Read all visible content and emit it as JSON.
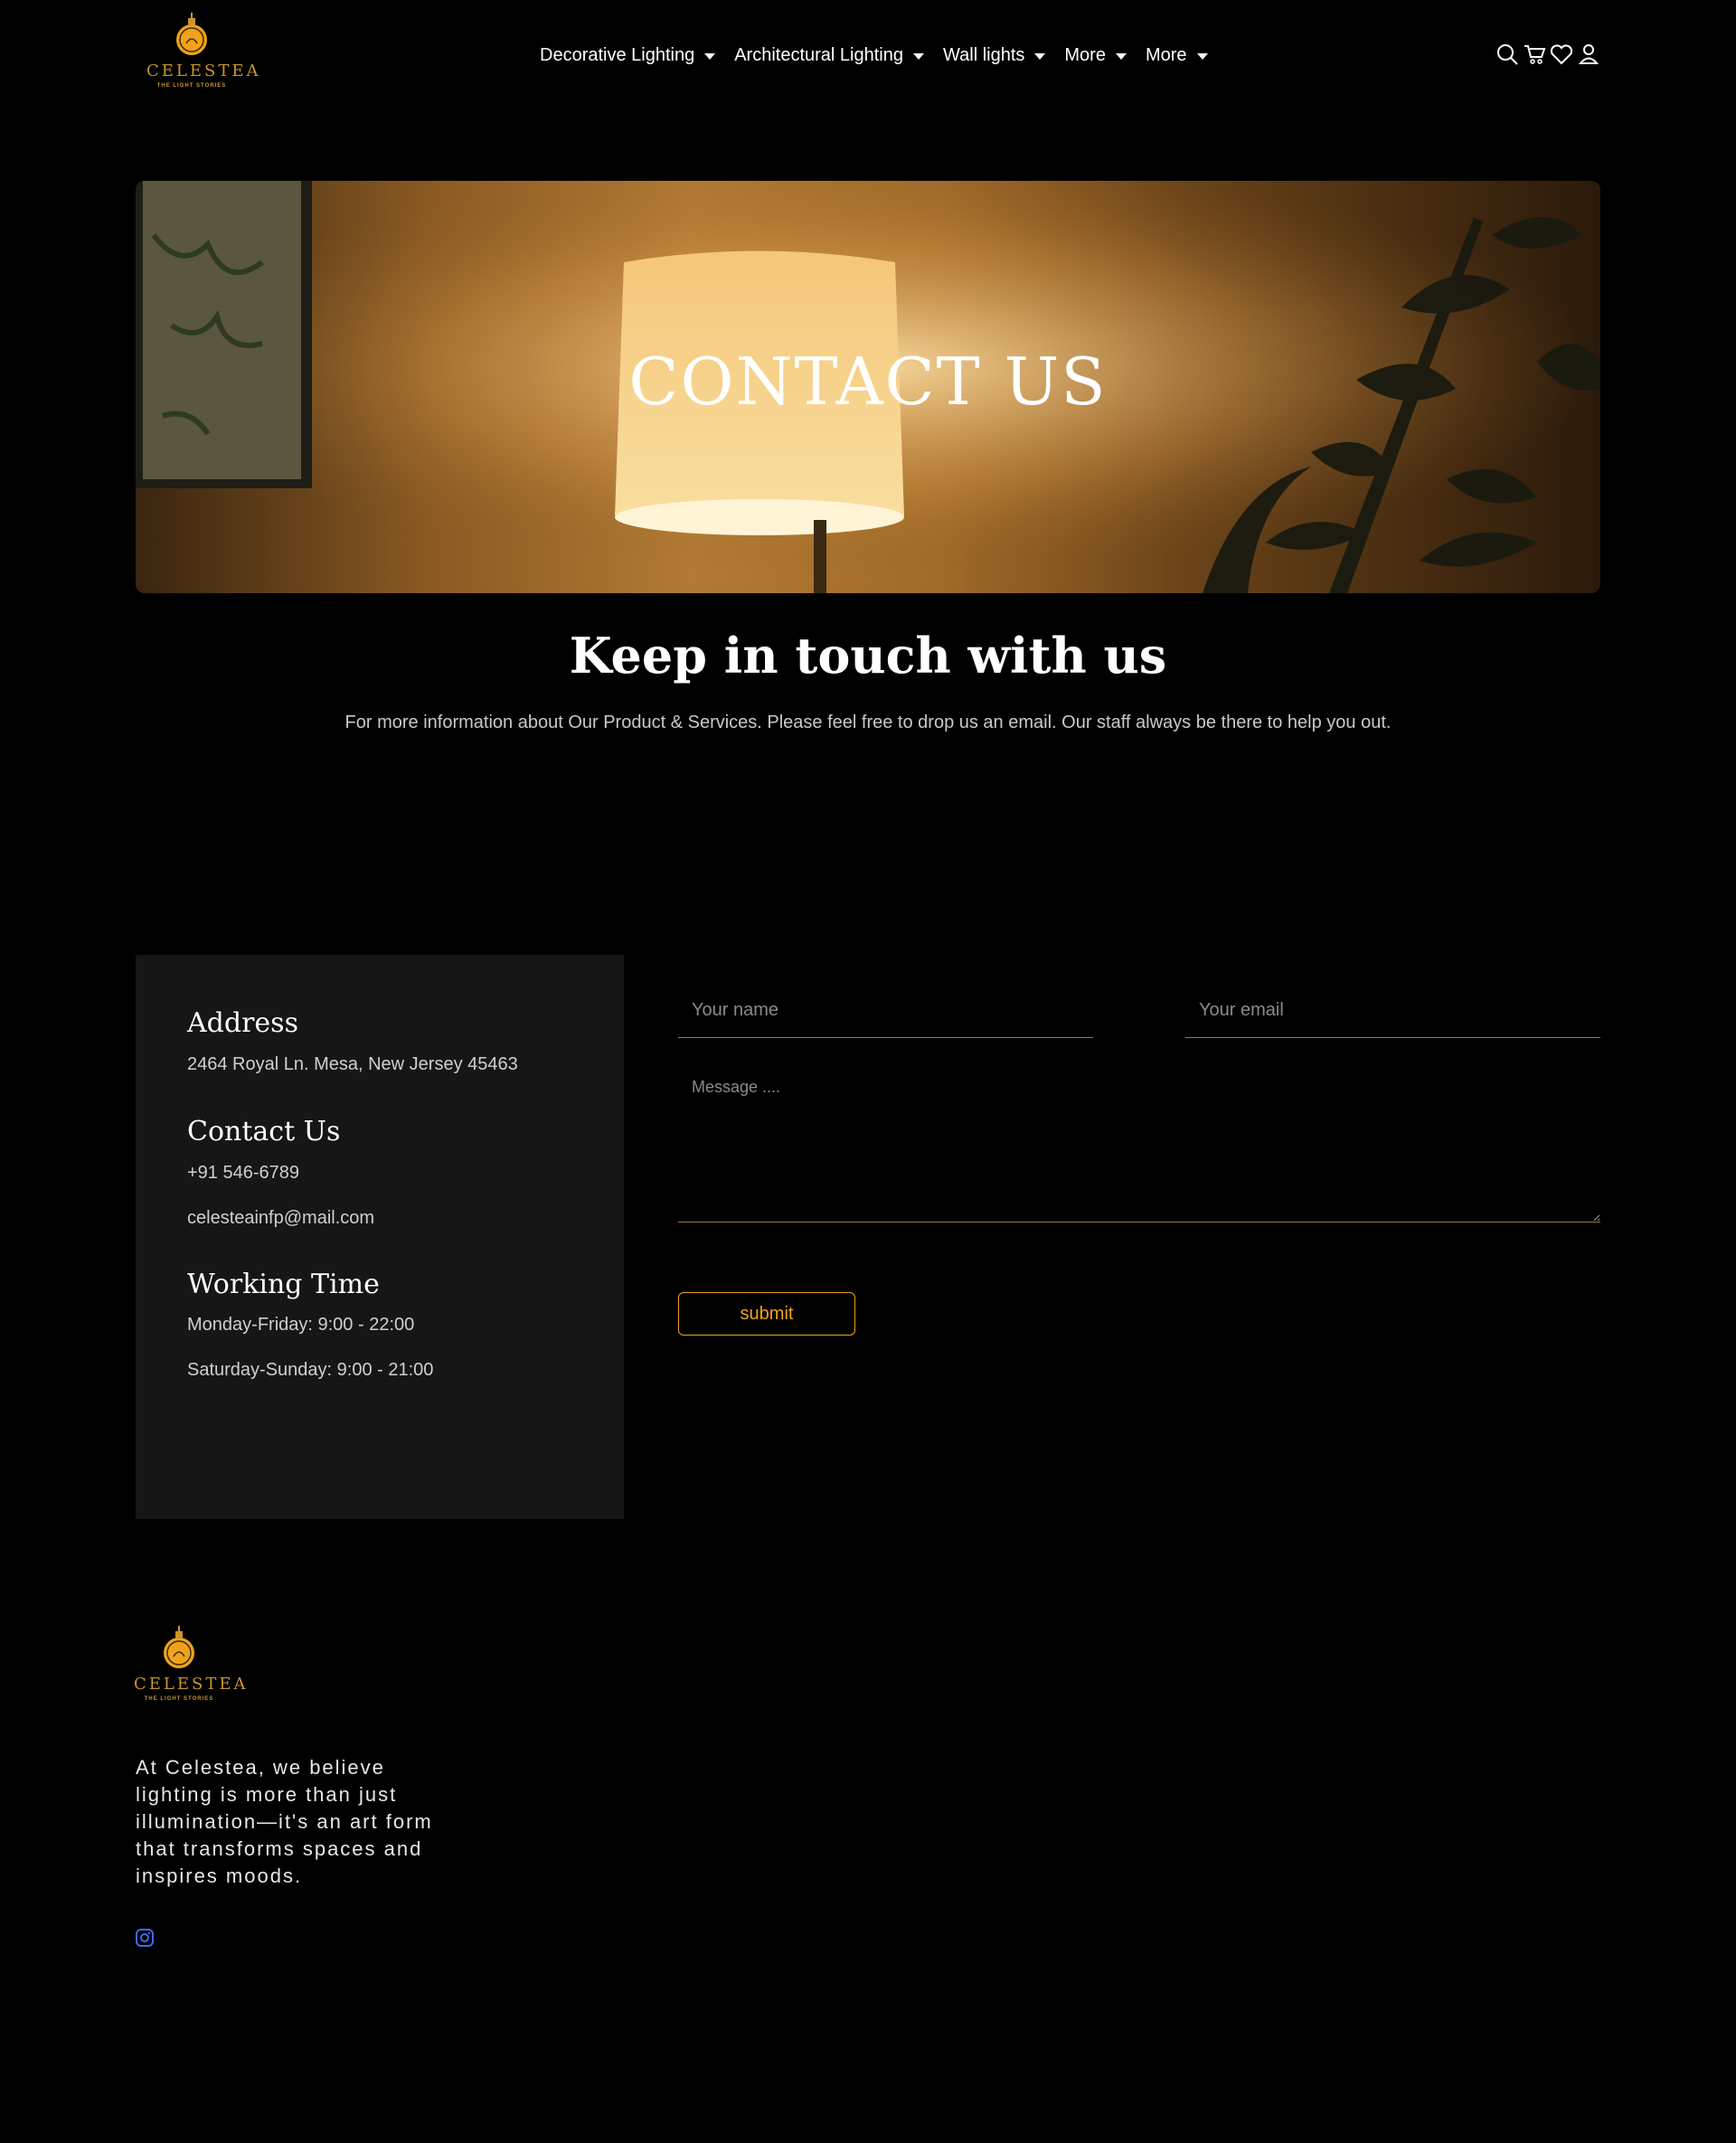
{
  "brand": {
    "name": "CELESTEA",
    "tagline": "THE LIGHT STORIES"
  },
  "nav": {
    "items": [
      {
        "label": "Decorative Lighting"
      },
      {
        "label": "Architectural Lighting"
      },
      {
        "label": "Wall lights"
      },
      {
        "label": "More"
      },
      {
        "label": "More"
      }
    ],
    "icons": [
      "search-icon",
      "cart-icon",
      "heart-icon",
      "user-icon"
    ]
  },
  "hero": {
    "title": "CONTACT US"
  },
  "intro": {
    "title": "Keep in touch with us",
    "text": "For more information about Our Product & Services. Please feel free to drop us an email. Our staff always be there to help you out."
  },
  "info": {
    "address_heading": "Address",
    "address": "2464 Royal Ln. Mesa, New Jersey 45463",
    "contact_heading": "Contact Us",
    "phone": "+91 546-6789",
    "email": "celesteainfp@mail.com",
    "hours_heading": "Working Time",
    "weekdays": "Monday-Friday: 9:00 - 22:00",
    "weekend": "Saturday-Sunday: 9:00 - 21:00"
  },
  "form": {
    "name_placeholder": "Your name",
    "email_placeholder": "Your email",
    "message_placeholder": "Message ....",
    "submit_label": "submit"
  },
  "footer": {
    "about": "At Celestea, we believe lighting is more than just illumination—it's an art form that transforms spaces and inspires moods.",
    "social_icon": "instagram-icon"
  },
  "colors": {
    "accent": "#f0a31a",
    "gold": "#c9962a",
    "card": "#161616",
    "background": "#000000"
  }
}
